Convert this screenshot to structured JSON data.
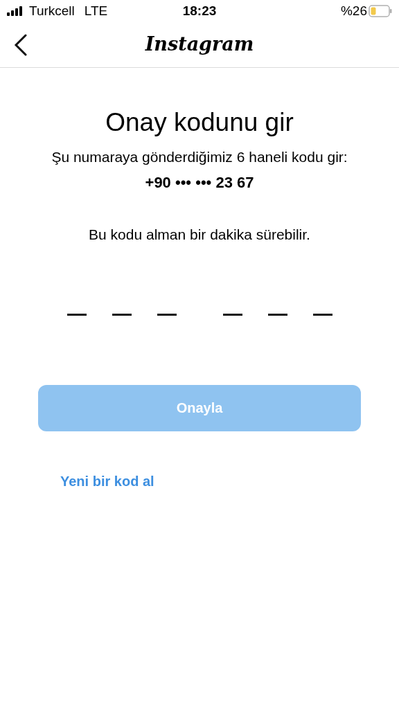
{
  "status_bar": {
    "carrier": "Turkcell",
    "network": "LTE",
    "time": "18:23",
    "battery": "%26"
  },
  "header": {
    "logo_text": "Instagram"
  },
  "title": "Onay kodunu gir",
  "description": "Şu numaraya gönderdiğimiz 6 haneli kodu gir:",
  "phone": "+90 ••• ••• 23 67",
  "note": "Bu kodu alman bir dakika sürebilir.",
  "code_slots": [
    {
      "filled": false
    },
    {
      "filled": false
    },
    {
      "filled": false
    },
    {
      "filled": false
    },
    {
      "filled": false
    },
    {
      "filled": false
    }
  ],
  "confirm_button": {
    "label": "Onayla",
    "disabled": true
  },
  "resend_link": "Yeni bir kod al"
}
